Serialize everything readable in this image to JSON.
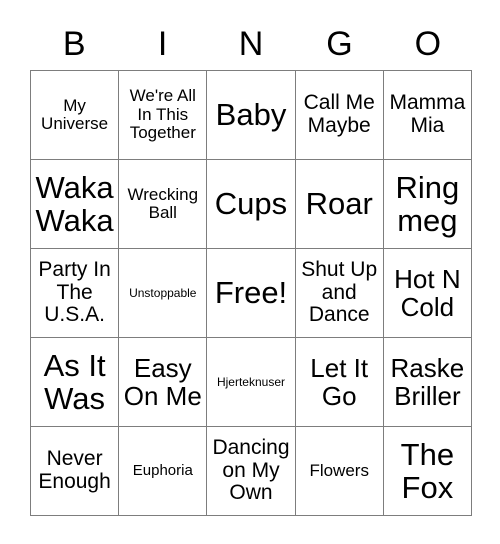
{
  "card": {
    "title": "BINGO",
    "header_letters": [
      "B",
      "I",
      "N",
      "G",
      "O"
    ],
    "colors": {
      "background": "#ffffff",
      "text": "#000000",
      "grid_line": "#7d7d7d"
    },
    "grid_size": "5x5",
    "free_space": "Free!",
    "cells": [
      {
        "text": "My Universe",
        "size": "fs-md"
      },
      {
        "text": "We're All In This Together",
        "size": "fs-md"
      },
      {
        "text": "Baby",
        "size": "fs-xxl"
      },
      {
        "text": "Call Me Maybe",
        "size": "fs-lg"
      },
      {
        "text": "Mamma Mia",
        "size": "fs-lg"
      },
      {
        "text": "Waka Waka",
        "size": "fs-xxl"
      },
      {
        "text": "Wrecking Ball",
        "size": "fs-md"
      },
      {
        "text": "Cups",
        "size": "fs-xxl"
      },
      {
        "text": "Roar",
        "size": "fs-xxl"
      },
      {
        "text": "Ring meg",
        "size": "fs-xxl"
      },
      {
        "text": "Party In The U.S.A.",
        "size": "fs-lg"
      },
      {
        "text": "Unstoppable",
        "size": "fs-xs"
      },
      {
        "text": "Free!",
        "size": "fs-xxl"
      },
      {
        "text": "Shut Up and Dance",
        "size": "fs-lg"
      },
      {
        "text": "Hot N Cold",
        "size": "fs-xl"
      },
      {
        "text": "As It Was",
        "size": "fs-xxl"
      },
      {
        "text": "Easy On Me",
        "size": "fs-xl"
      },
      {
        "text": "Hjerteknuser",
        "size": "fs-xs"
      },
      {
        "text": "Let It Go",
        "size": "fs-xl"
      },
      {
        "text": "Raske Briller",
        "size": "fs-xl"
      },
      {
        "text": "Never Enough",
        "size": "fs-lg"
      },
      {
        "text": "Euphoria",
        "size": "fs-sm"
      },
      {
        "text": "Dancing on My Own",
        "size": "fs-lg"
      },
      {
        "text": "Flowers",
        "size": "fs-md"
      },
      {
        "text": "The Fox",
        "size": "fs-xxl"
      }
    ]
  }
}
